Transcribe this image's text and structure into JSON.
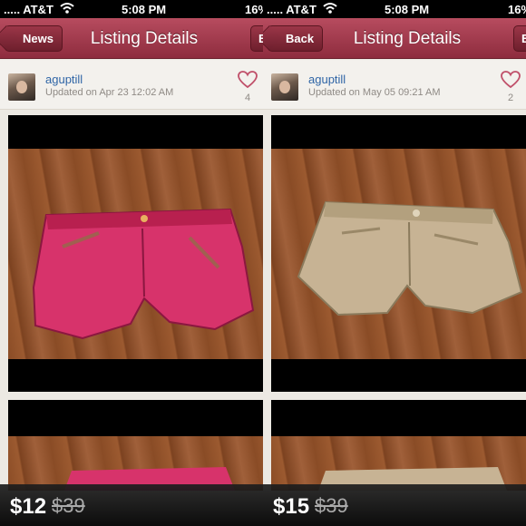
{
  "panels": [
    {
      "status": {
        "carrier": "..... AT&T",
        "time": "5:08 PM",
        "battery": "16%"
      },
      "nav": {
        "back_label": "News",
        "title": "Listing Details",
        "edge_label": "E"
      },
      "listing": {
        "username": "aguptill",
        "updated": "Updated on Apr 23 12:02 AM",
        "likes": "4",
        "price": "$12",
        "original_price": "$39",
        "photo_color": "#d7336b"
      }
    },
    {
      "status": {
        "carrier": "..... AT&T",
        "time": "5:08 PM",
        "battery": "16%"
      },
      "nav": {
        "back_label": "Back",
        "title": "Listing Details",
        "edge_label": "E"
      },
      "listing": {
        "username": "aguptill",
        "updated": "Updated on May 05 09:21 AM",
        "likes": "2",
        "price": "$15",
        "original_price": "$39",
        "photo_color": "#c7b394"
      }
    }
  ],
  "icons": {
    "wifi": "wifi-icon",
    "like": "heart-icon",
    "back": "chevron-left-icon"
  },
  "colors": {
    "nav_bar": "#9c3547",
    "username_link": "#2f65a6",
    "like_heart": "#c0506a"
  }
}
